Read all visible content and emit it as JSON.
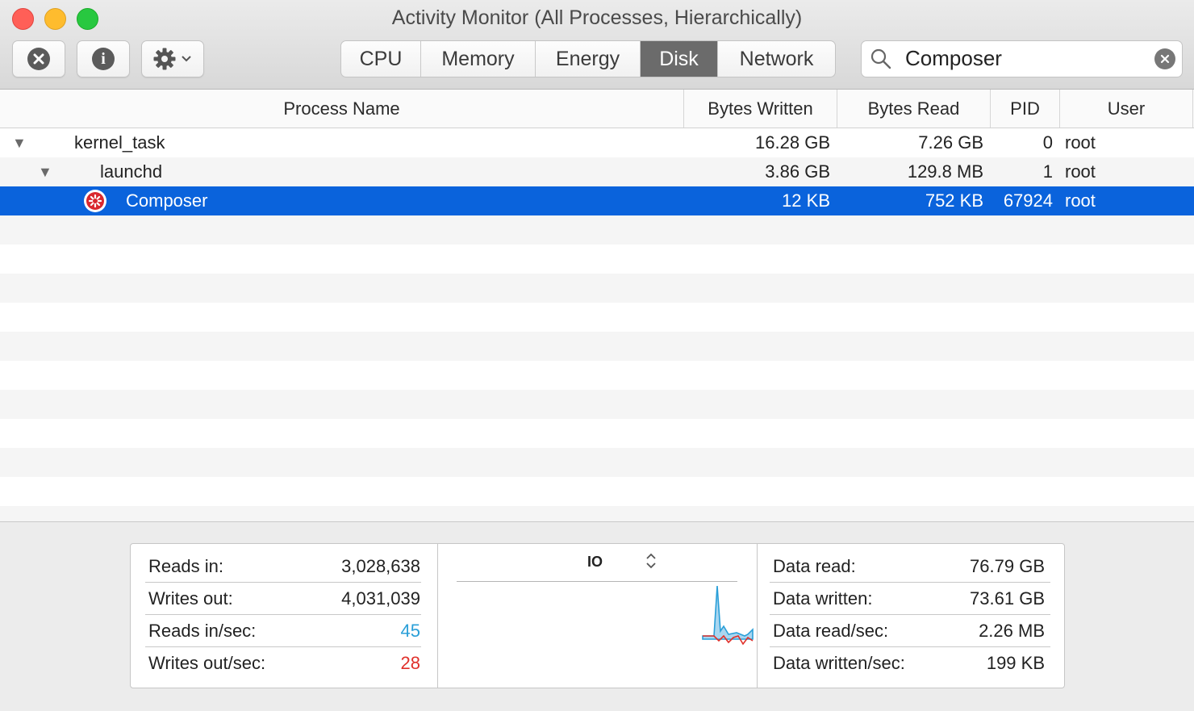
{
  "window": {
    "title": "Activity Monitor (All Processes, Hierarchically)"
  },
  "toolbar": {
    "stop_icon": "x-circle-icon",
    "info_icon": "info-icon",
    "action_icon": "gear-icon",
    "tabs": [
      {
        "label": "CPU",
        "active": false
      },
      {
        "label": "Memory",
        "active": false
      },
      {
        "label": "Energy",
        "active": false
      },
      {
        "label": "Disk",
        "active": true
      },
      {
        "label": "Network",
        "active": false
      }
    ],
    "search": {
      "value": "Composer"
    }
  },
  "table": {
    "columns": [
      "Process Name",
      "Bytes Written",
      "Bytes Read",
      "PID",
      "User"
    ],
    "rows": [
      {
        "name": "kernel_task",
        "bytes_written": "16.28 GB",
        "bytes_read": "7.26 GB",
        "pid": "0",
        "user": "root",
        "level": 0,
        "expanded": true
      },
      {
        "name": "launchd",
        "bytes_written": "3.86 GB",
        "bytes_read": "129.8 MB",
        "pid": "1",
        "user": "root",
        "level": 1,
        "expanded": true
      },
      {
        "name": "Composer",
        "bytes_written": "12 KB",
        "bytes_read": "752 KB",
        "pid": "67924",
        "user": "root",
        "level": 2,
        "selected": true,
        "icon": "composer-app-icon"
      }
    ]
  },
  "stats": {
    "left": [
      {
        "label": "Reads in:",
        "value": "3,028,638"
      },
      {
        "label": "Writes out:",
        "value": "4,031,039"
      },
      {
        "label": "Reads in/sec:",
        "value": "45",
        "color": "#2a9fd8"
      },
      {
        "label": "Writes out/sec:",
        "value": "28",
        "color": "#e0302a"
      }
    ],
    "graph": {
      "selector": "IO"
    },
    "right": [
      {
        "label": "Data read:",
        "value": "76.79 GB"
      },
      {
        "label": "Data written:",
        "value": "73.61 GB"
      },
      {
        "label": "Data read/sec:",
        "value": "2.26 MB"
      },
      {
        "label": "Data written/sec:",
        "value": "199 KB"
      }
    ]
  },
  "colors": {
    "selection": "#0a63dc",
    "read_series": "#2a9fd8",
    "write_series": "#e0302a"
  }
}
